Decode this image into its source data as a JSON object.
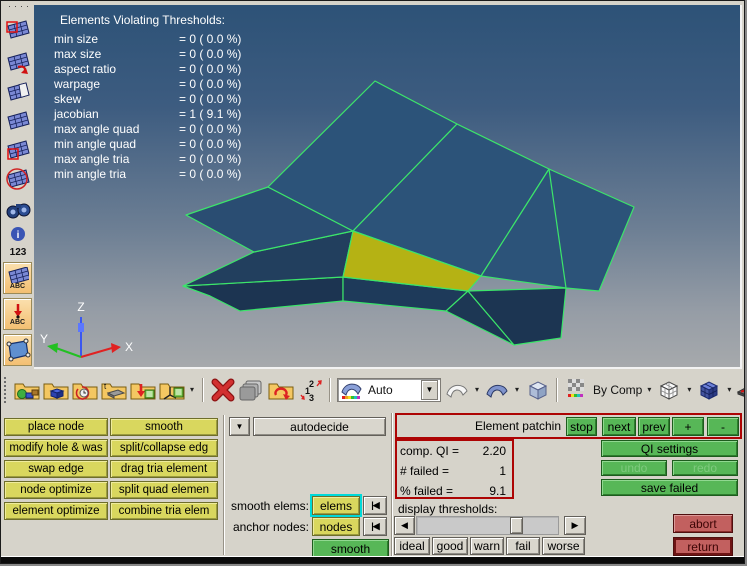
{
  "viewport": {
    "overlay": {
      "title": "Elements Violating Thresholds:",
      "rows": [
        {
          "label": "min size",
          "value": "= 0 ( 0.0 %)"
        },
        {
          "label": "max size",
          "value": "= 0 ( 0.0 %)"
        },
        {
          "label": "aspect ratio",
          "value": "= 0 ( 0.0 %)"
        },
        {
          "label": "warpage",
          "value": "= 0 ( 0.0 %)"
        },
        {
          "label": "skew",
          "value": "= 0 ( 0.0 %)"
        },
        {
          "label": "jacobian",
          "value": "= 1 ( 9.1 %)"
        },
        {
          "label": "max angle quad",
          "value": "= 0 ( 0.0 %)"
        },
        {
          "label": "min angle quad",
          "value": "= 0 ( 0.0 %)"
        },
        {
          "label": "max angle tria",
          "value": "= 0 ( 0.0 %)"
        },
        {
          "label": "min angle tria",
          "value": "= 0 ( 0.0 %)"
        }
      ]
    },
    "axis": {
      "x": "X",
      "y": "Y",
      "z": "Z"
    }
  },
  "sidebar": {
    "numbers_label": "123",
    "abc_label": "ABC",
    "icons": [
      "mesh-window-icon",
      "mesh-arrow-icon",
      "mesh-half-icon",
      "mesh-solid-icon",
      "mesh-select-icon",
      "mesh-circle-icon",
      "binoculars-icon",
      "info-icon",
      "numbers-label",
      "mesh-abc-button",
      "arrow-abc-button",
      "surface-nodes-button"
    ]
  },
  "toolbar": {
    "auto_label": "Auto",
    "by_comp_label": "By Comp",
    "icons": [
      "drag-handle",
      "open-model-icon",
      "solid-geometry-icon",
      "recent-files-icon",
      "thickness-icon",
      "import-list-icon",
      "axes-list-icon",
      "delete-x-icon",
      "panels-stack-icon",
      "reload-icon",
      "renumber-123-icon",
      "shading-auto-combo",
      "wireframe-shell-icon",
      "shaded-shell-icon",
      "cube-icon",
      "checker-by-comp",
      "wireframe-cube-icon",
      "shaded-cube-icon",
      "element-thickness-icon",
      "clipped-sphere-icon"
    ]
  },
  "icons": {
    "dropdown": "▼",
    "left": "◀",
    "right": "▶",
    "reset": "|◀",
    "caret": "▾"
  },
  "panel": {
    "edit_buttons": [
      "place node",
      "smooth",
      "modify hole & was",
      "split/collapse edg",
      "swap edge",
      "drag tria element",
      "node optimize",
      "split quad elemen",
      "element optimize",
      "combine tria elem"
    ],
    "autodecide": "autodecide",
    "smooth_elems_label": "smooth elems:",
    "elems_value": "elems",
    "anchor_nodes_label": "anchor nodes:",
    "nodes_value": "nodes",
    "smooth_button": "smooth",
    "patch": {
      "title": "Element patchin",
      "buttons": [
        "stop",
        "next",
        "prev",
        "+",
        "-"
      ],
      "stats": [
        {
          "label": "comp. QI =",
          "value": "2.20"
        },
        {
          "label": "# failed =",
          "value": "1"
        },
        {
          "label": "% failed =",
          "value": "9.1"
        }
      ],
      "qi_settings": "QI settings",
      "undo": "undo",
      "redo": "redo",
      "save_failed": "save failed"
    },
    "thresholds": {
      "label": "display thresholds:",
      "buttons": [
        "ideal",
        "good",
        "warn",
        "fail",
        "worse"
      ]
    },
    "abort": "abort",
    "return_label": "return"
  },
  "colors": {
    "accent_green": "#57b757",
    "button_yellow": "#d9d75e",
    "alert_border_red": "#ad0404",
    "abort_red": "#c2605f",
    "highlight_cyan": "#00d9d9",
    "mesh_fill": "#2c5379",
    "failed_element_yellow": "#b5b214",
    "mesh_edge_green": "#3ce56a",
    "viewport_top": "#2d5277",
    "viewport_bottom": "#a6a9ac"
  }
}
